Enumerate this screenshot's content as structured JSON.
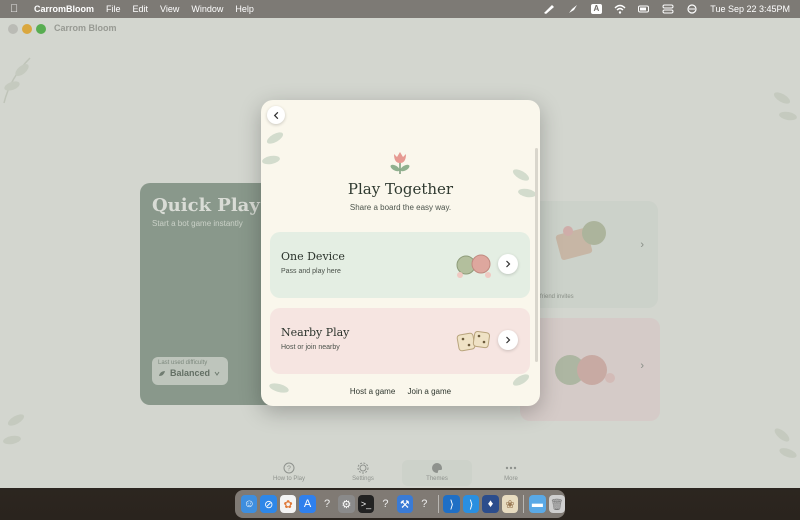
{
  "menubar": {
    "app_name": "CarromBloom",
    "menus": [
      "File",
      "Edit",
      "View",
      "Window",
      "Help"
    ],
    "input_badge": "A",
    "clock": "Tue Sep 22  3:45PM"
  },
  "window": {
    "title": "Carrom Bloom"
  },
  "quick_play": {
    "title": "Quick Play",
    "subtitle": "Start a bot game instantly",
    "difficulty_label": "Last used difficulty",
    "difficulty_value": "Balanced"
  },
  "friend_card": {
    "label": "friend invites"
  },
  "modal": {
    "title": "Play Together",
    "subtitle": "Share a board the easy way.",
    "options": [
      {
        "title": "One Device",
        "subtitle": "Pass and play here"
      },
      {
        "title": "Nearby Play",
        "subtitle": "Host or join nearby"
      }
    ],
    "host_link": "Host a game",
    "join_link": "Join a game"
  },
  "tabs": [
    {
      "label": "How to Play",
      "icon": "question-circle-icon"
    },
    {
      "label": "Settings",
      "icon": "gear-icon"
    },
    {
      "label": "Themes",
      "icon": "palette-icon"
    },
    {
      "label": "More",
      "icon": "ellipsis-icon"
    }
  ],
  "colors": {
    "quick_play_bg": "#8d9e90",
    "one_device_bg": "#e4eee3",
    "nearby_bg": "#f6e5e1",
    "modal_bg": "#faf7ec"
  },
  "dock": [
    "finder-icon",
    "safari-icon",
    "photos-icon",
    "app-store-icon",
    "help-icon",
    "settings-icon",
    "terminal-icon",
    "help-icon",
    "xcode-icon",
    "help-icon",
    "vscode-icon",
    "vscode-icon",
    "instruments-icon",
    "carrombloom-icon",
    "folder-icon",
    "trash-icon"
  ]
}
